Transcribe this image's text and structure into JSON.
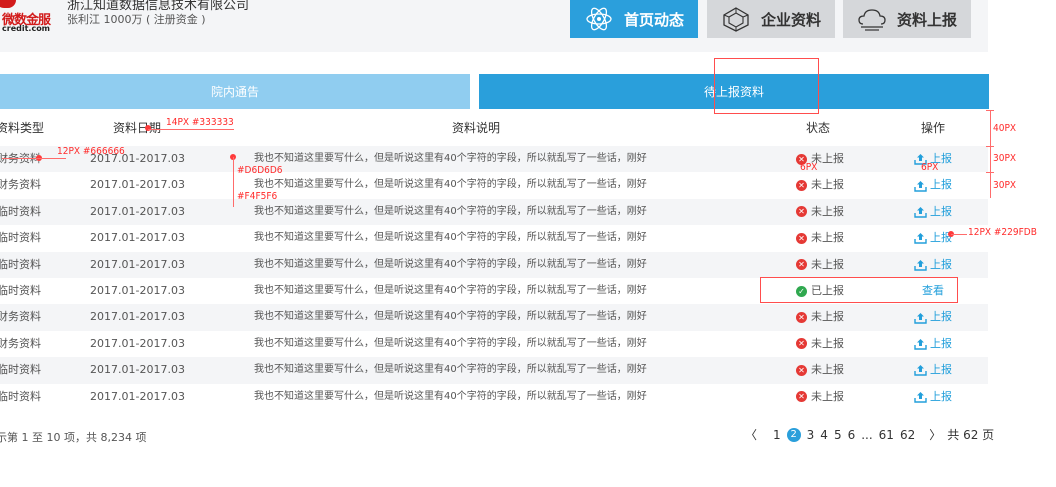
{
  "header": {
    "logo_text": "微数金服",
    "logo_url": "credit.com",
    "company_name": "浙江知道数据信息技术有限公司",
    "company_sub": "张利江 1000万 ( 注册资金 )",
    "nav": [
      {
        "label": "首页动态",
        "icon": "atom-icon"
      },
      {
        "label": "企业资料",
        "icon": "network-icon"
      },
      {
        "label": "资料上报",
        "icon": "upload-cloud-icon"
      }
    ]
  },
  "tabs": [
    {
      "label": "院内通告"
    },
    {
      "label": "待上报资料"
    }
  ],
  "table": {
    "headers": [
      "资料类型",
      "资料日期",
      "资料说明",
      "状态",
      "操作"
    ],
    "rows": [
      {
        "type": "财务资料",
        "date": "2017.01-2017.03",
        "desc": "我也不知道这里要写什么，但是听说这里有40个字符的字段，所以就乱写了一些话，刚好",
        "status": "未上报",
        "action": "上报"
      },
      {
        "type": "财务资料",
        "date": "2017.01-2017.03",
        "desc": "我也不知道这里要写什么，但是听说这里有40个字符的字段，所以就乱写了一些话，刚好",
        "status": "未上报",
        "action": "上报"
      },
      {
        "type": "临时资料",
        "date": "2017.01-2017.03",
        "desc": "我也不知道这里要写什么，但是听说这里有40个字符的字段，所以就乱写了一些话，刚好",
        "status": "未上报",
        "action": "上报"
      },
      {
        "type": "临时资料",
        "date": "2017.01-2017.03",
        "desc": "我也不知道这里要写什么，但是听说这里有40个字符的字段，所以就乱写了一些话，刚好",
        "status": "未上报",
        "action": "上报"
      },
      {
        "type": "临时资料",
        "date": "2017.01-2017.03",
        "desc": "我也不知道这里要写什么，但是听说这里有40个字符的字段，所以就乱写了一些话，刚好",
        "status": "未上报",
        "action": "上报"
      },
      {
        "type": "临时资料",
        "date": "2017.01-2017.03",
        "desc": "我也不知道这里要写什么，但是听说这里有40个字符的字段，所以就乱写了一些话，刚好",
        "status": "已上报",
        "action": "查看"
      },
      {
        "type": "财务资料",
        "date": "2017.01-2017.03",
        "desc": "我也不知道这里要写什么，但是听说这里有40个字符的字段，所以就乱写了一些话，刚好",
        "status": "未上报",
        "action": "上报"
      },
      {
        "type": "财务资料",
        "date": "2017.01-2017.03",
        "desc": "我也不知道这里要写什么，但是听说这里有40个字符的字段，所以就乱写了一些话，刚好",
        "status": "未上报",
        "action": "上报"
      },
      {
        "type": "临时资料",
        "date": "2017.01-2017.03",
        "desc": "我也不知道这里要写什么，但是听说这里有40个字符的字段，所以就乱写了一些话，刚好",
        "status": "未上报",
        "action": "上报"
      },
      {
        "type": "临时资料",
        "date": "2017.01-2017.03",
        "desc": "我也不知道这里要写什么，但是听说这里有40个字符的字段，所以就乱写了一些话，刚好",
        "status": "未上报",
        "action": "上报"
      }
    ]
  },
  "footer": {
    "info": "示第 1 至 10 项，共 8,234 项",
    "pager": {
      "prev": "〈",
      "pages": [
        "1",
        "2",
        "3",
        "4",
        "5",
        "6",
        "...",
        "61",
        "62"
      ],
      "active": "2",
      "next": "〉",
      "total": "共 62 页"
    }
  },
  "annotations": {
    "type_font": "12PX #666666",
    "header_font": "14PX #333333",
    "row_color_a": "#D6D6D6",
    "row_color_b": "#F4F5F6",
    "header_height": "40PX",
    "row_height_1": "30PX",
    "row_height_2": "30PX",
    "status_gap": "6PX",
    "action_gap": "6PX",
    "action_font": "12PX #229FDB"
  },
  "colors": {
    "accent": "#2a9fdb",
    "tab_inactive": "#90cdf0",
    "error": "#e53935",
    "success": "#2fa84f"
  }
}
